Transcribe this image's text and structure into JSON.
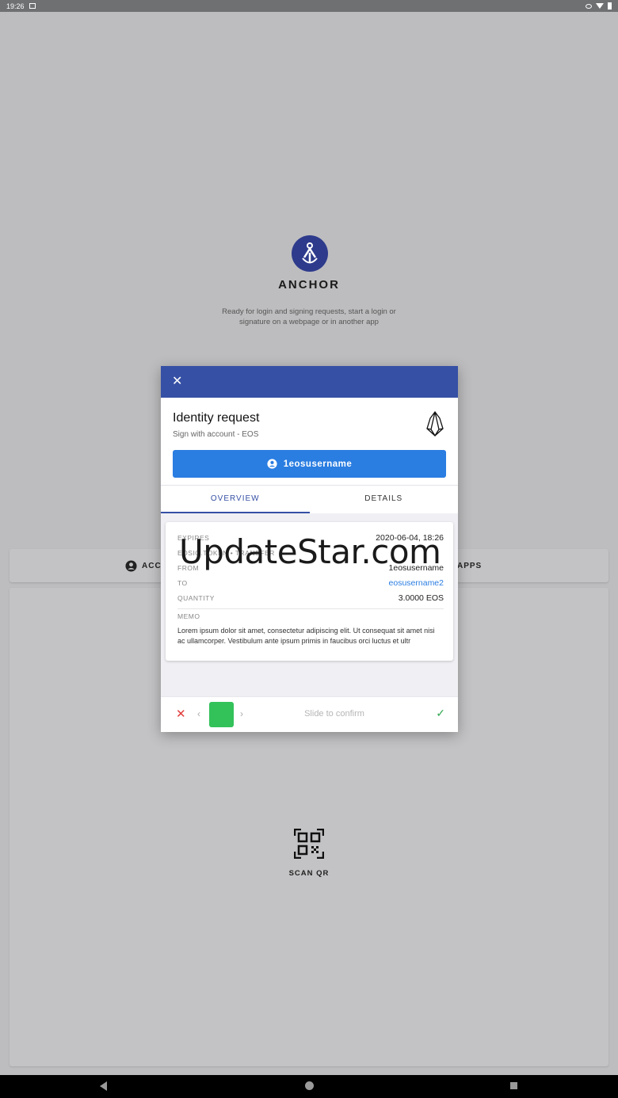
{
  "status_bar": {
    "time": "19:26"
  },
  "brand": {
    "name": "ANCHOR",
    "tagline": "Ready for login and signing requests, start a login or signature on a webpage or in another app"
  },
  "main_tabs": {
    "accounts_label": "ACC",
    "apps_label": "APPS"
  },
  "scan": {
    "label": "SCAN QR",
    "icon": "qr-scan-icon"
  },
  "modal": {
    "title": "Identity request",
    "subtitle": "Sign with account - EOS",
    "account_button": "1eosusername",
    "tabs": {
      "overview": "OVERVIEW",
      "details": "DETAILS"
    },
    "details": {
      "expires_key": "EXPIRES",
      "expires_value": "2020-06-04, 18:26",
      "contract_key": "EOSIO.TOKEN • TRANSFER",
      "from_key": "FROM",
      "from_value": "1eosusername",
      "to_key": "TO",
      "to_value": "eosusername2",
      "quantity_key": "QUANTITY",
      "quantity_value": "3.0000 EOS",
      "memo_key": "MEMO",
      "memo_value": "Lorem ipsum dolor sit amet, consectetur adipiscing elit. Ut consequat sit amet nisi ac ullamcorper. Vestibulum ante ipsum primis in faucibus orci luctus et ultr"
    },
    "slider": {
      "label": "Slide to confirm"
    }
  },
  "watermark": "UpdateStar.com",
  "colors": {
    "header": "#3650a5",
    "account_button": "#2a7de1",
    "knob": "#33c25a",
    "cancel": "#e23b3b",
    "confirm": "#33a852"
  }
}
